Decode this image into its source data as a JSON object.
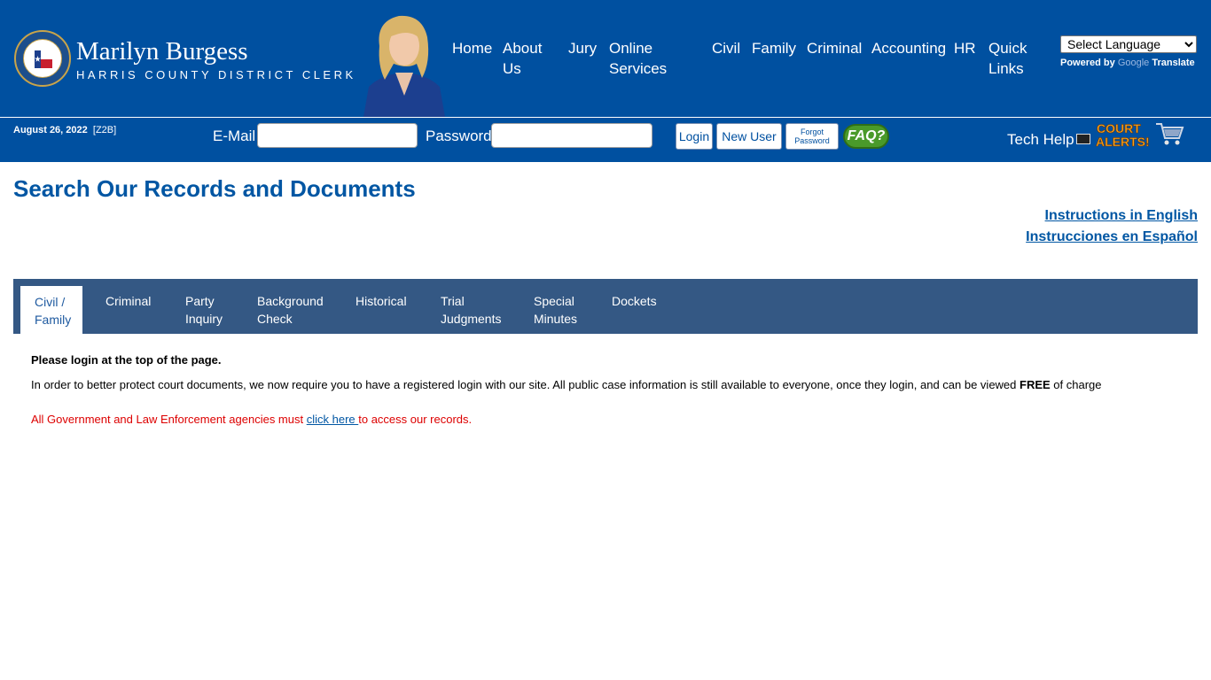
{
  "brand": {
    "name": "Marilyn Burgess",
    "subtitle": "HARRIS COUNTY DISTRICT CLERK"
  },
  "nav": [
    {
      "line1": "Home",
      "line2": ""
    },
    {
      "line1": "About",
      "line2": "Us"
    },
    {
      "line1": "Jury",
      "line2": ""
    },
    {
      "line1": "Online",
      "line2": "Services"
    },
    {
      "line1": "Civil",
      "line2": ""
    },
    {
      "line1": "Family",
      "line2": ""
    },
    {
      "line1": "Criminal",
      "line2": ""
    },
    {
      "line1": "Accounting",
      "line2": ""
    },
    {
      "line1": "HR",
      "line2": ""
    },
    {
      "line1": "Quick",
      "line2": "Links"
    }
  ],
  "language": {
    "select_label": "Select Language",
    "powered_by": "Powered by",
    "google": "Google",
    "translate": "Translate"
  },
  "loginbar": {
    "date": "August 26, 2022",
    "code": "[Z2B]",
    "email_label": "E-Mail",
    "password_label": "Password",
    "login_button": "Login",
    "new_user_button": "New User",
    "forgot_line1": "Forgot",
    "forgot_line2": "Password",
    "faq": "FAQ?",
    "tech_help": "Tech Help",
    "court_alerts_line1": "COURT",
    "court_alerts_line2": "ALERTS!"
  },
  "main": {
    "title": "Search Our Records and Documents",
    "instructions_en": "Instructions in English",
    "instructions_es": "Instrucciones en Español"
  },
  "tabs": [
    {
      "line1": "Civil /",
      "line2": "Family",
      "active": true
    },
    {
      "line1": "Criminal",
      "line2": ""
    },
    {
      "line1": "Party",
      "line2": "Inquiry"
    },
    {
      "line1": "Background",
      "line2": "Check"
    },
    {
      "line1": "Historical",
      "line2": ""
    },
    {
      "line1": "Trial",
      "line2": "Judgments"
    },
    {
      "line1": "Special",
      "line2": "Minutes"
    },
    {
      "line1": "Dockets",
      "line2": ""
    }
  ],
  "content": {
    "login_notice": "Please login at the top of the page.",
    "protect_text": "In order to better protect court documents, we now require you to have a registered login with our site. All public case information is still available to everyone, once they login, and can be viewed ",
    "free": "FREE",
    "charge": " of charge",
    "gov_text": "All Government and Law Enforcement agencies must ",
    "click_here": "click here ",
    "gov_text_end": "to access our records."
  },
  "colors": {
    "header_blue": "#0050a0",
    "tab_bar": "#345884",
    "title_blue": "#0056a3",
    "alert_red": "#dd0000"
  }
}
